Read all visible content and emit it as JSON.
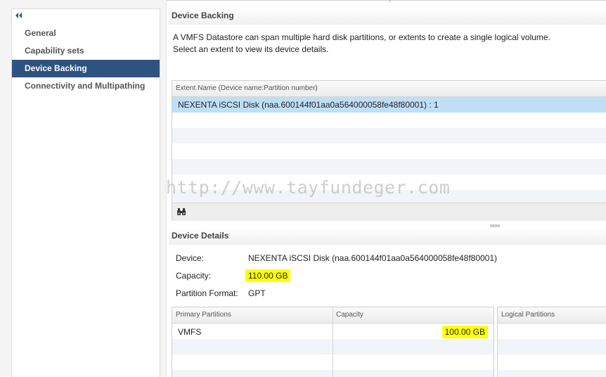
{
  "nav": {
    "items": [
      {
        "label": "General",
        "selected": false
      },
      {
        "label": "Capability sets",
        "selected": false
      },
      {
        "label": "Device Backing",
        "selected": true
      },
      {
        "label": "Connectivity and Multipathing",
        "selected": false
      }
    ]
  },
  "device_backing": {
    "title": "Device Backing",
    "description_line1": "A VMFS Datastore can span multiple hard disk partitions, or extents to create a single logical volume.",
    "description_line2": "Select an extent to view its device details.",
    "grid": {
      "column_header": "Extent Name (Device name:Partition number)",
      "rows": [
        "NEXENTA iSCSI Disk (naa.600144f01aa0a564000058fe48f80001) : 1"
      ],
      "selected_row": 0
    }
  },
  "device_details": {
    "title": "Device Details",
    "device_label": "Device:",
    "device_value": "NEXENTA iSCSI Disk (naa.600144f01aa0a564000058fe48f80001)",
    "capacity_label": "Capacity:",
    "capacity_value": "110.00 GB",
    "partition_format_label": "Partition Format:",
    "partition_format_value": "GPT",
    "partitions_grid": {
      "headers": [
        "Primary Partitions",
        "Capacity"
      ],
      "rows": [
        {
          "name": "VMFS",
          "capacity": "100.00 GB"
        }
      ]
    },
    "logical_grid": {
      "header": "Logical Partitions"
    }
  },
  "watermark": "http://www.tayfundeger.com",
  "colors": {
    "nav_selected_bg": "#2f5380",
    "row_selected_bg": "#bfdff7",
    "highlight": "#ffff00"
  },
  "icons": {
    "collapse": "double-chevron-left-icon",
    "find": "binoculars-icon",
    "splitter": "splitter-grip-icon"
  }
}
